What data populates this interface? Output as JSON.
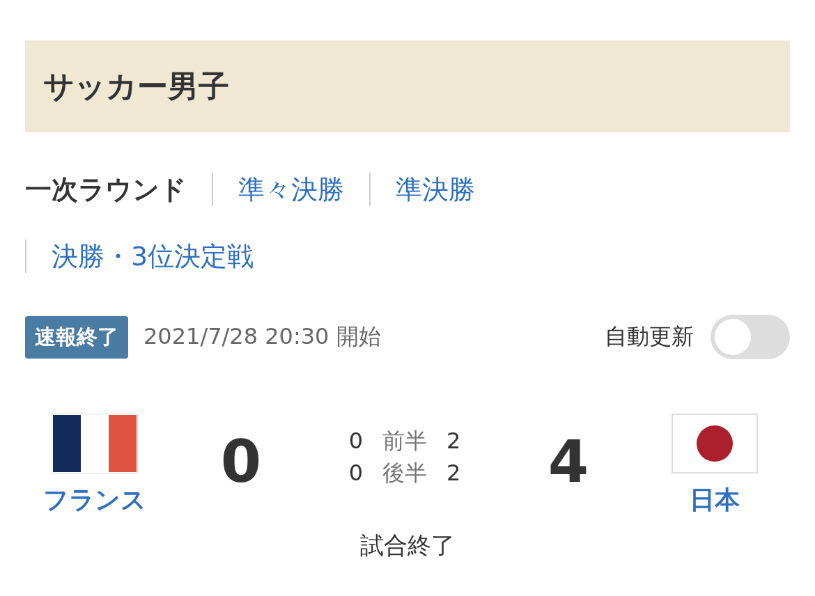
{
  "header": {
    "title": "サッカー男子"
  },
  "tabs": [
    {
      "label": "一次ラウンド",
      "selected": true
    },
    {
      "label": "準々決勝",
      "selected": false
    },
    {
      "label": "準決勝",
      "selected": false
    },
    {
      "label": "決勝・3位決定戦",
      "selected": false
    }
  ],
  "status": {
    "badge": "速報終了",
    "start_time": "2021/7/28 20:30 開始",
    "auto_update": {
      "label": "自動更新",
      "on": false
    }
  },
  "match": {
    "home": {
      "name": "フランス",
      "flag": {
        "kind": "france"
      },
      "score": "0"
    },
    "away": {
      "name": "日本",
      "flag": {
        "kind": "japan"
      },
      "score": "4"
    },
    "halves": [
      {
        "home": "0",
        "label": "前半",
        "away": "2"
      },
      {
        "home": "0",
        "label": "後半",
        "away": "2"
      }
    ],
    "result": "試合終了"
  }
}
